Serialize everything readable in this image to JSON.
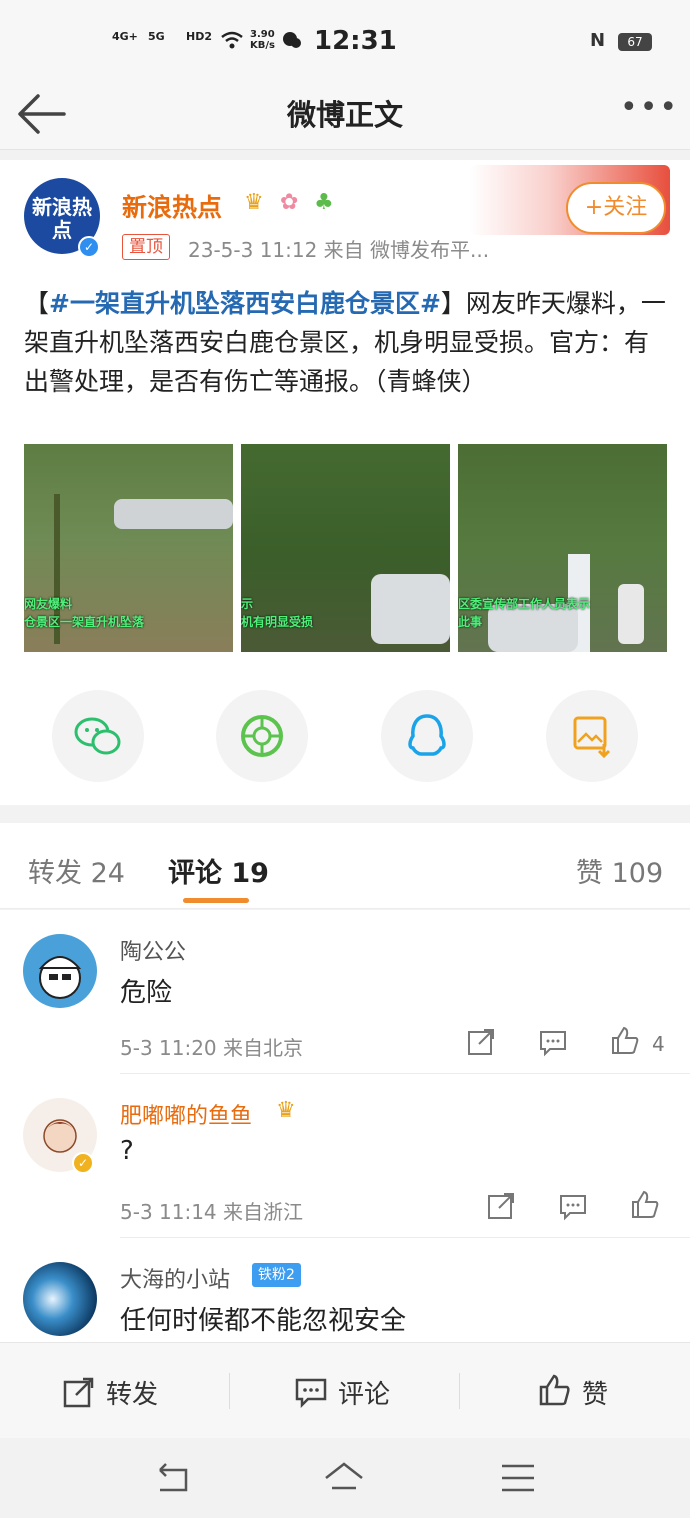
{
  "status_bar": {
    "net1": "4G+",
    "net2": "5G",
    "hd": "HD2",
    "speed": "3.90 KB/s",
    "time": "12:31",
    "battery": "67"
  },
  "header": {
    "title": "微博正文"
  },
  "post": {
    "author": "新浪热点",
    "avatar_text": "新浪热点",
    "pinned_label": "置顶",
    "meta": "23-5-3 11:12  来自 微博发布平...",
    "follow_label": "+关注",
    "text_open": "【",
    "hashtag": "#一架直升机坠落西安白鹿仓景区#",
    "text_rest": "】网友昨天爆料，一架直升机坠落西安白鹿仓景区，机身明显受损。官方：有出警处理，是否有伤亡等通报。（青蜂侠）",
    "photos": [
      {
        "caption_line1": "网友爆料",
        "caption_line2": "仓景区一架直升机坠落"
      },
      {
        "caption_line1": "示",
        "caption_line2": "机有明显受损"
      },
      {
        "caption_line1": "区委宣传部工作人员表示",
        "caption_line2": "此事"
      }
    ],
    "share_icons": [
      "wechat-icon",
      "moments-icon",
      "qq-icon",
      "save-image-icon"
    ]
  },
  "tabs": {
    "repost": "转发 24",
    "comment": "评论 19",
    "like": "赞 109"
  },
  "comments": [
    {
      "name": "陶公公",
      "text": "危险",
      "meta": "5-3 11:20  来自北京",
      "likes": "4"
    },
    {
      "name": "肥嘟嘟的鱼鱼",
      "text": "?",
      "meta": "5-3 11:14  来自浙江",
      "likes": ""
    },
    {
      "name": "大海的小站",
      "badge": "铁粉2",
      "text": "任何时候都不能忽视安全"
    }
  ],
  "actions": {
    "repost": "转发",
    "comment": "评论",
    "like": "赞"
  },
  "colors": {
    "accent": "#f08c2d",
    "hashtag": "#2569b3",
    "vip_name": "#e86b0e"
  }
}
